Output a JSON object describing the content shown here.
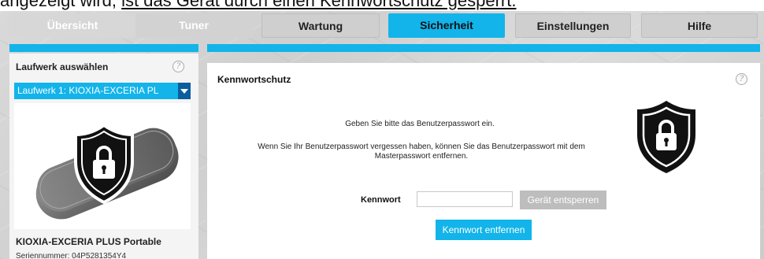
{
  "caption": {
    "text_plain": "angezeigt wird, ",
    "text_underlined": "ist das Gerät durch einen Kennwortschutz gesperrt."
  },
  "tabs": [
    {
      "label": "Übersicht",
      "state": "disabled"
    },
    {
      "label": "Tuner",
      "state": "disabled"
    },
    {
      "label": "Wartung",
      "state": "normal"
    },
    {
      "label": "Sicherheit",
      "state": "active"
    },
    {
      "label": "Einstellungen",
      "state": "normal"
    },
    {
      "label": "Hilfe",
      "state": "normal"
    }
  ],
  "sidebar": {
    "title": "Laufwerk auswählen",
    "help_icon": "?",
    "selected_drive": "Laufwerk 1: KIOXIA-EXCERIA PL",
    "drive_name": "KIOXIA-EXCERIA PLUS Portable",
    "serial_label": "Seriennummer: 04P5281354Y4"
  },
  "main": {
    "title": "Kennwortschutz",
    "help_icon": "?",
    "message_1": "Geben Sie bitte das Benutzerpasswort ein.",
    "message_2": "Wenn Sie Ihr Benutzerpasswort vergessen haben, können Sie das Benutzerpasswort mit dem Masterpasswort entfernen.",
    "password_label": "Kennwort",
    "password_value": "",
    "unlock_button": "Gerät entsperren",
    "remove_button": "Kennwort entfernen"
  },
  "icons": {
    "drive_shield": "shield-lock-icon",
    "main_shield": "shield-lock-icon"
  },
  "colors": {
    "accent": "#12b4ea",
    "dark_accent": "#0a5d9e",
    "disabled_button": "#bdbdbd"
  }
}
